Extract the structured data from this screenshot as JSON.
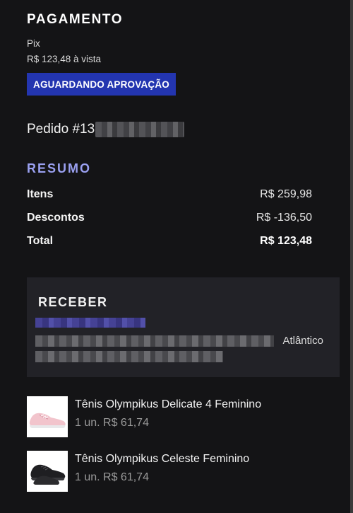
{
  "payment": {
    "title": "PAGAMENTO",
    "method": "Pix",
    "amount_text": "R$ 123,48 à vista",
    "status_badge": "AGUARDANDO APROVAÇÃO"
  },
  "order": {
    "label": "Pedido #13"
  },
  "summary": {
    "title": "RESUMO",
    "rows": [
      {
        "label": "Itens",
        "value": "R$ 259,98"
      },
      {
        "label": "Descontos",
        "value": "R$ -136,50"
      },
      {
        "label": "Total",
        "value": "R$ 123,48"
      }
    ]
  },
  "receive": {
    "title": "RECEBER",
    "partial_text": "Atlântico"
  },
  "products": [
    {
      "name": "Tênis Olympikus Delicate 4 Feminino",
      "qty_price": "1 un. R$ 61,74",
      "thumb_icon": "pink-sneaker-icon"
    },
    {
      "name": "Tênis Olympikus Celeste Feminino",
      "qty_price": "1 un. R$ 61,74",
      "thumb_icon": "black-sneaker-icon"
    }
  ],
  "colors": {
    "background": "#141416",
    "badge": "#2335b0",
    "summary_title": "#9aa0f0",
    "receive_card": "#222227"
  }
}
